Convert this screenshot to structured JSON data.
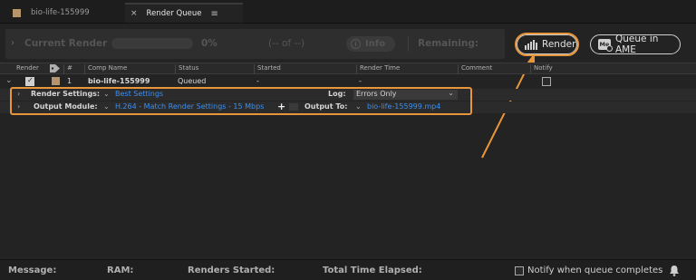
{
  "tabs": [
    {
      "label": "bio-life-155999",
      "active": false
    },
    {
      "label": "Render Queue",
      "active": true
    }
  ],
  "icons": {
    "tab_close": "close-icon",
    "tab_menu": "hamburger-menu-icon",
    "info": "info-icon",
    "render": "render-bars-icon",
    "ame": "media-encoder-icon",
    "label": "tag-icon",
    "bell": "bell-icon"
  },
  "render_strip": {
    "current_render_label": "Current Render",
    "percent": "0%",
    "progress": 0,
    "of_text": "(-- of --)",
    "info_label": "Info",
    "remaining_label": "Remaining:"
  },
  "buttons": {
    "render": "Render",
    "queue_in_ame": "Queue in AME",
    "ame_icon_text": "Me"
  },
  "columns": [
    "Render",
    "#",
    "Comp Name",
    "Status",
    "Started",
    "Render Time",
    "Comment",
    "Notify"
  ],
  "rows": [
    {
      "render": true,
      "label_color": "#b8946a",
      "index": "1",
      "comp_name": "bio-life-155999",
      "status": "Queued",
      "started": "-",
      "render_time": "-",
      "notify": false
    }
  ],
  "render_settings": {
    "label": "Render Settings:",
    "value": "Best Settings",
    "log_label": "Log:",
    "log_value": "Errors Only"
  },
  "output_module": {
    "label": "Output Module:",
    "value": "H.264 - Match Render Settings - 15 Mbps",
    "output_to_label": "Output To:",
    "output_to_value": "bio-life-155999.mp4"
  },
  "footer": {
    "message": "Message:",
    "ram": "RAM:",
    "renders_started": "Renders Started:",
    "total_time_elapsed": "Total Time Elapsed:",
    "notify_label": "Notify when queue completes",
    "notify_checked": false
  },
  "colors": {
    "highlight": "#e8963b",
    "link": "#3d8ff0",
    "label_swatch": "#b8946a"
  }
}
